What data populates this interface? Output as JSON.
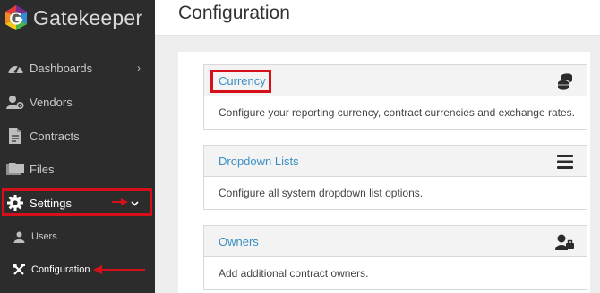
{
  "brand": {
    "name": "Gatekeeper"
  },
  "sidebar": {
    "items": [
      {
        "label": "Dashboards",
        "icon": "gauge-icon",
        "has_chevron": true
      },
      {
        "label": "Vendors",
        "icon": "user-gear-icon"
      },
      {
        "label": "Contracts",
        "icon": "document-icon"
      },
      {
        "label": "Files",
        "icon": "folders-icon"
      },
      {
        "label": "Settings",
        "icon": "gear-icon",
        "expanded": true
      }
    ],
    "sub_items": [
      {
        "label": "Users",
        "icon": "user-icon"
      },
      {
        "label": "Configuration",
        "icon": "tools-icon",
        "active": true
      }
    ]
  },
  "main": {
    "title": "Configuration",
    "cards": [
      {
        "title": "Currency",
        "description": "Configure your reporting currency, contract currencies and exchange rates.",
        "icon": "coins-icon"
      },
      {
        "title": "Dropdown Lists",
        "description": "Configure all system dropdown list options.",
        "icon": "list-icon"
      },
      {
        "title": "Owners",
        "description": "Add additional contract owners.",
        "icon": "user-plus-icon"
      }
    ]
  },
  "colors": {
    "sidebar_bg": "#2c2c2c",
    "link": "#3a8fc4",
    "highlight": "#d6101a"
  }
}
